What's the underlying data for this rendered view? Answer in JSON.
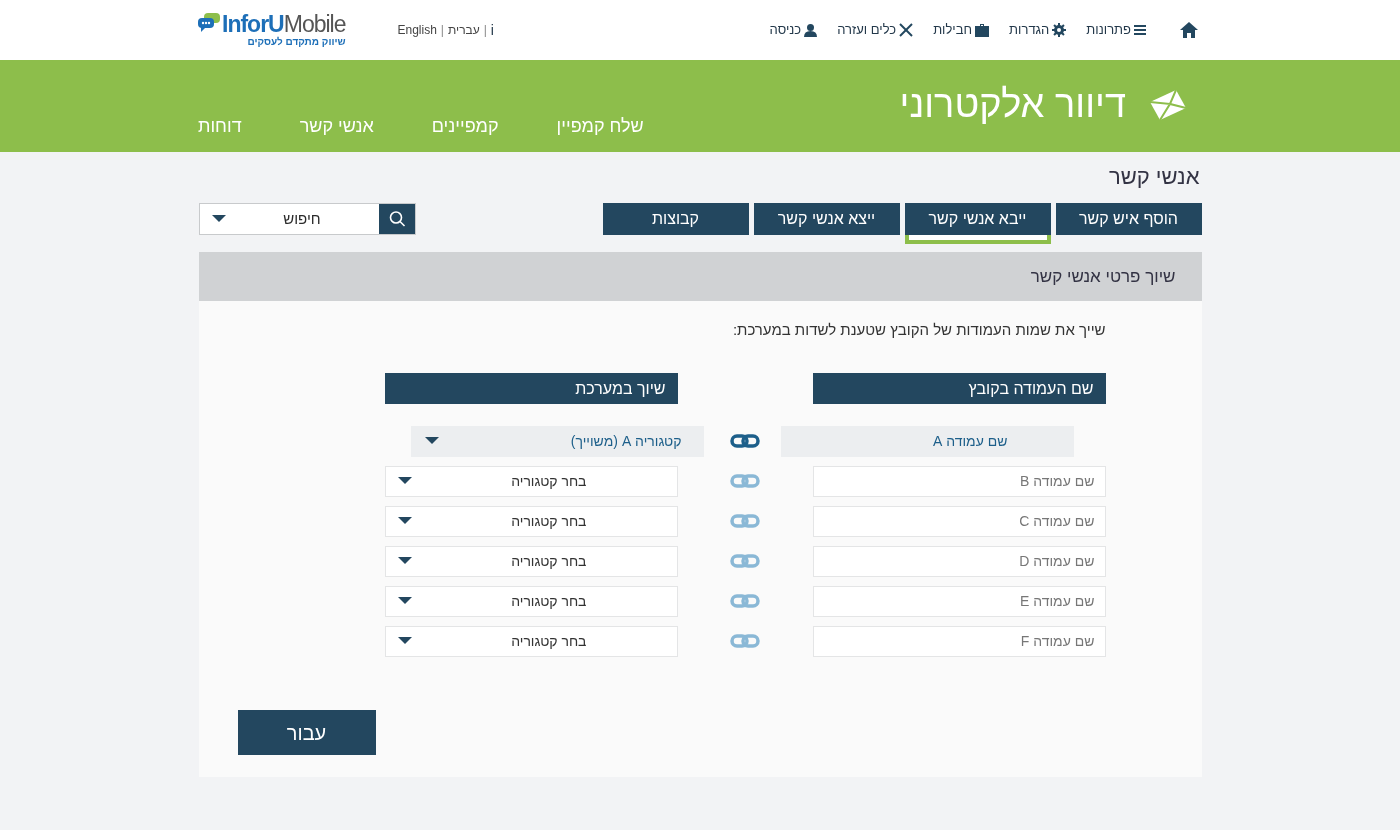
{
  "header": {
    "logo": {
      "brand_1": "InforU",
      "brand_2": "Mobile",
      "tagline": "שיווק מתקדם לעסקים"
    },
    "languages": {
      "items": [
        "i",
        "עברית",
        "English"
      ],
      "separator": "|"
    },
    "nav": [
      {
        "kind": "home"
      },
      {
        "label": "פתרונות",
        "kind": "menu"
      },
      {
        "label": "הגדרות",
        "kind": "gear"
      },
      {
        "label": "חבילות",
        "kind": "case"
      },
      {
        "label": "כלים ועזרה",
        "kind": "tools"
      },
      {
        "label": "כניסה",
        "kind": "user"
      }
    ]
  },
  "banner": {
    "title": "דיוור אלקטרוני",
    "menu": [
      "שלח קמפיין",
      "קמפיינים",
      "אנשי קשר",
      "דוחות"
    ]
  },
  "page_title": "אנשי קשר",
  "tabs": [
    {
      "label": "הוסף איש קשר",
      "selected": false
    },
    {
      "label": "ייבא אנשי קשר",
      "selected": true
    },
    {
      "label": "ייצא אנשי קשר",
      "selected": false
    },
    {
      "label": "קבוצות",
      "selected": false
    }
  ],
  "search": {
    "value": "חיפוש"
  },
  "panel": {
    "title": "שיוך פרטי אנשי קשר",
    "instructions": "שייך את שמות העמודות של הקובץ שטענת לשדות במערכת:",
    "columns": [
      "שם העמודה בקובץ",
      "שיוך במערכת"
    ],
    "rows": [
      {
        "column_name": "שם עמודה A",
        "category": "קטגוריה A (משוייך)",
        "mapped": true
      },
      {
        "column_name": "שם עמודה B",
        "category": "בחר קטגוריה",
        "mapped": false
      },
      {
        "column_name": "שם עמודה C",
        "category": "בחר קטגוריה",
        "mapped": false
      },
      {
        "column_name": "שם עמודה D",
        "category": "בחר קטגוריה",
        "mapped": false
      },
      {
        "column_name": "שם עמודה E",
        "category": "בחר קטגוריה",
        "mapped": false
      },
      {
        "column_name": "שם עמודה F",
        "category": "בחר קטגוריה",
        "mapped": false
      }
    ],
    "submit": "עבור"
  }
}
